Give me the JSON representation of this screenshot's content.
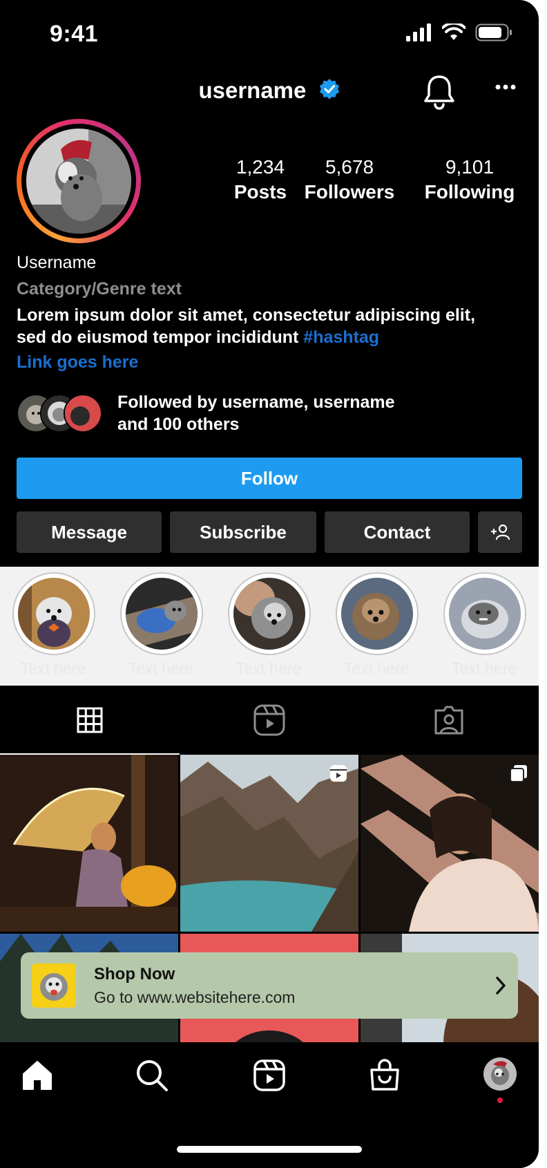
{
  "status": {
    "time": "9:41"
  },
  "header": {
    "username": "username"
  },
  "stats": [
    {
      "value": "1,234",
      "label": "Posts"
    },
    {
      "value": "5,678",
      "label": "Followers"
    },
    {
      "value": "9,101",
      "label": "Following"
    }
  ],
  "bio": {
    "name": "Username",
    "category": "Category/Genre text",
    "text_line1": "Lorem ipsum dolor sit amet, consectetur adipiscing elit,",
    "text_line2": "sed do eiusmod tempor incididunt ",
    "hashtag": "#hashtag",
    "link": "Link goes here"
  },
  "followed_by": {
    "line1": "Followed by username, username",
    "line2": "and 100 others"
  },
  "buttons": {
    "follow": "Follow",
    "message": "Message",
    "subscribe": "Subscribe",
    "contact": "Contact"
  },
  "highlights": [
    {
      "label": "Text  here"
    },
    {
      "label": "Text  here"
    },
    {
      "label": "Text  here"
    },
    {
      "label": "Text  here"
    },
    {
      "label": "Text  here"
    }
  ],
  "tabs": [
    {
      "icon": "grid-icon",
      "active": true
    },
    {
      "icon": "reels-icon",
      "active": false
    },
    {
      "icon": "tagged-icon",
      "active": false
    }
  ],
  "shop_banner": {
    "title": "Shop Now",
    "subtitle": "Go to www.websitehere.com"
  },
  "colors": {
    "accent_blue": "#1d9bf0",
    "link_blue": "#1a6fd0",
    "banner_green": "#b5c9aa",
    "notification_red": "#e3173d"
  },
  "bottom_nav": [
    "home-icon",
    "search-icon",
    "reels-icon",
    "shop-icon",
    "profile-avatar"
  ]
}
